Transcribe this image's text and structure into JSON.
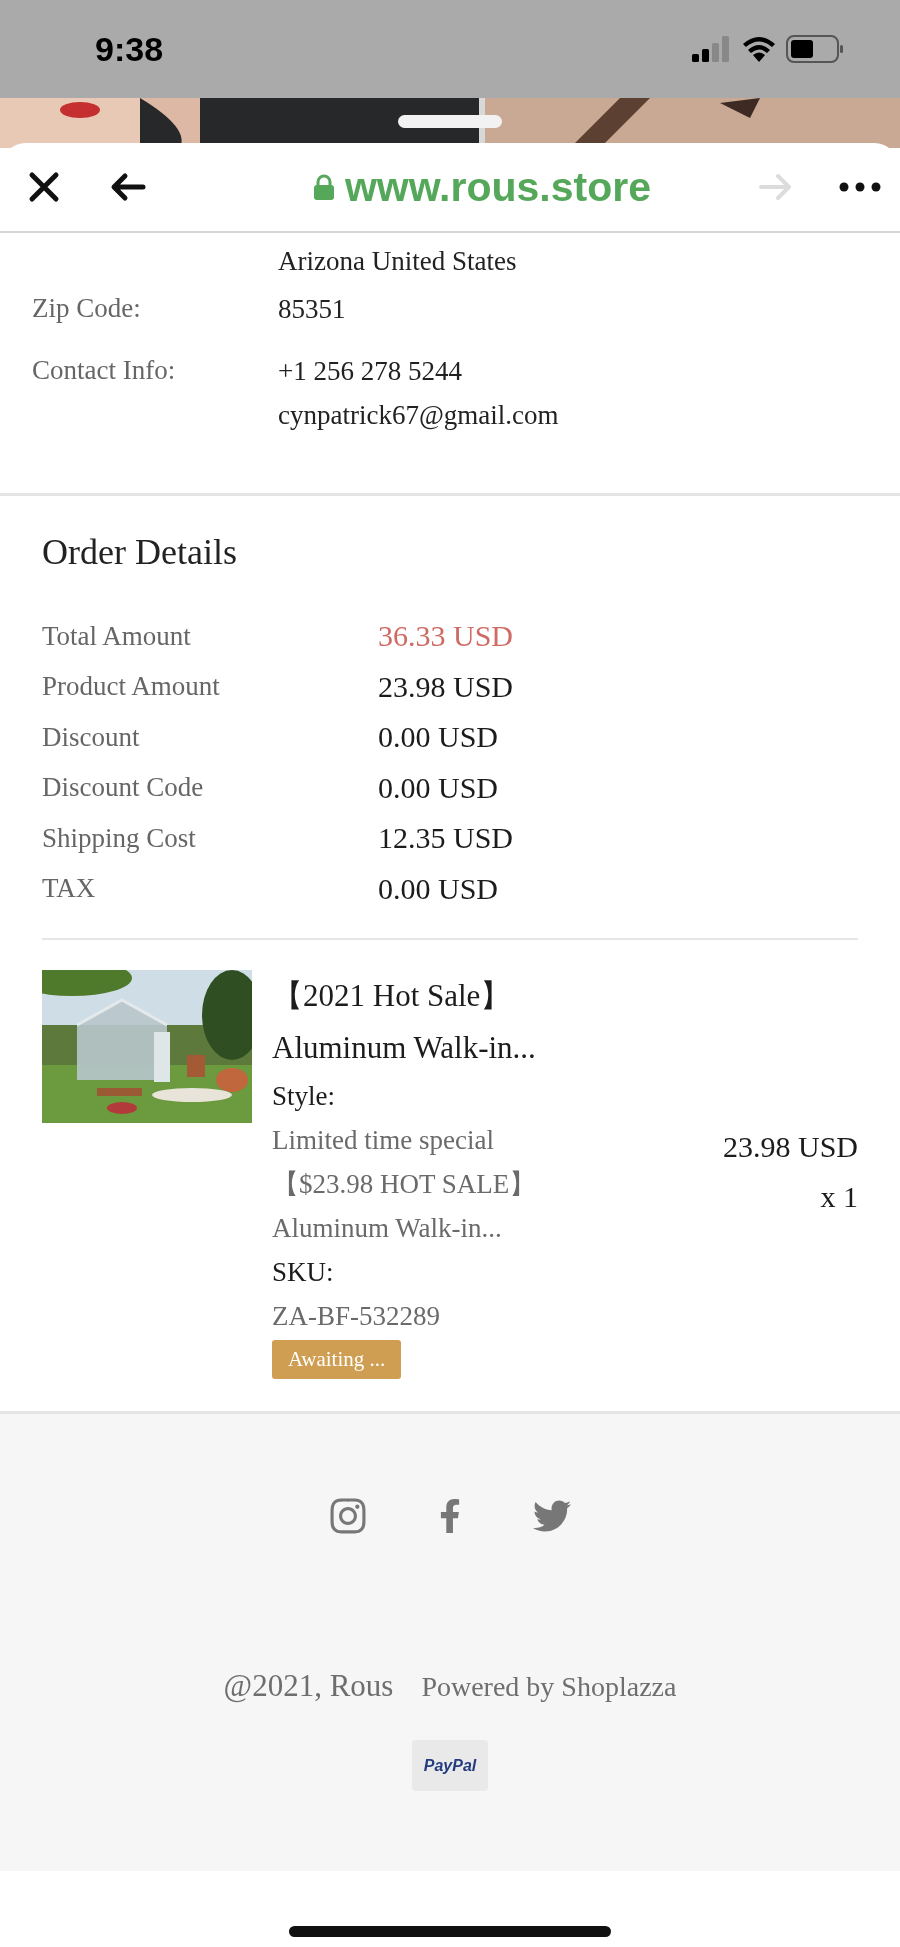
{
  "status_bar": {
    "time": "9:38"
  },
  "browser": {
    "url": "www.rous.store",
    "forward_disabled": true
  },
  "address": {
    "rows": [
      {
        "lines": [
          "Arizona United States"
        ]
      },
      {
        "label": "Zip Code:",
        "lines": [
          "85351"
        ]
      },
      {
        "label": "Contact Info:",
        "lines": [
          "+1 256 278 5244",
          "cynpatrick67@gmail.com"
        ]
      }
    ]
  },
  "order_details": {
    "title": "Order Details",
    "rows": [
      {
        "label": "Total Amount",
        "value": "36.33 USD",
        "emphasis": true
      },
      {
        "label": "Product Amount",
        "value": "23.98 USD",
        "emphasis": false
      },
      {
        "label": "Discount",
        "value": "0.00 USD",
        "emphasis": false
      },
      {
        "label": "Discount Code",
        "value": "0.00 USD",
        "emphasis": false
      },
      {
        "label": "Shipping Cost",
        "value": "12.35 USD",
        "emphasis": false
      },
      {
        "label": "TAX",
        "value": "0.00 USD",
        "emphasis": false
      }
    ]
  },
  "product": {
    "title_lines": [
      "【2021 Hot Sale】",
      "Aluminum Walk-in..."
    ],
    "style_label": "Style:",
    "style_lines": [
      "Limited time special",
      "【$23.98 HOT SALE】",
      "Aluminum Walk-in..."
    ],
    "sku_label": "SKU:",
    "sku": "ZA-BF-532289",
    "status": "Awaiting ...",
    "price": "23.98 USD",
    "quantity": "x 1"
  },
  "footer": {
    "copyright": "@2021, Rous",
    "powered_by": "Powered by Shoplazza",
    "payment": "PayPal"
  }
}
